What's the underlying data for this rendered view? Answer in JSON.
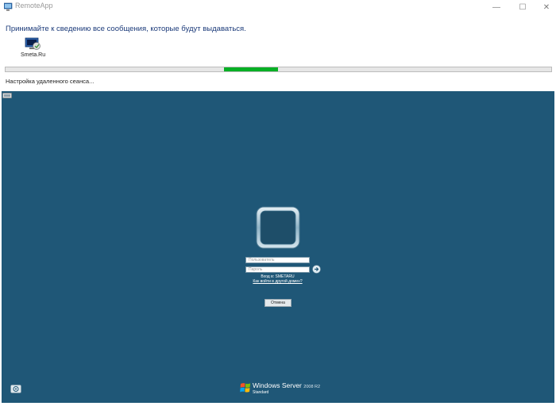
{
  "window": {
    "title": "RemoteApp",
    "minimize_symbol": "—",
    "maximize_symbol": "☐",
    "close_symbol": "✕"
  },
  "dialog": {
    "info_text": "Принимайте к сведению все сообщения, которые будут выдаваться.",
    "app_name": "Smeta.Ru",
    "status": "Настройка удаленного сеанса...",
    "progress": {
      "start": 0.4,
      "fraction": 0.1
    }
  },
  "session": {
    "background_color": "#1f5777",
    "username_placeholder": "Пользователь",
    "password_placeholder": "Пароль",
    "domain_text": "Вход в: SMETARU",
    "other_domain_link": "Как войти в другой домен?",
    "cancel_label": "Отмена"
  },
  "branding": {
    "name": "Windows Server",
    "version": "2008 R2",
    "edition": "Standard"
  },
  "icons": {
    "app": "remoteapp-icon",
    "remote_app": "remote-app-icon",
    "arrow": "arrow-right-icon",
    "ease_of_access": "ease-of-access-icon",
    "windows_logo": "windows-logo-icon"
  },
  "colors": {
    "progress_fill": "#06b025",
    "info_text": "#1c3b7a"
  }
}
